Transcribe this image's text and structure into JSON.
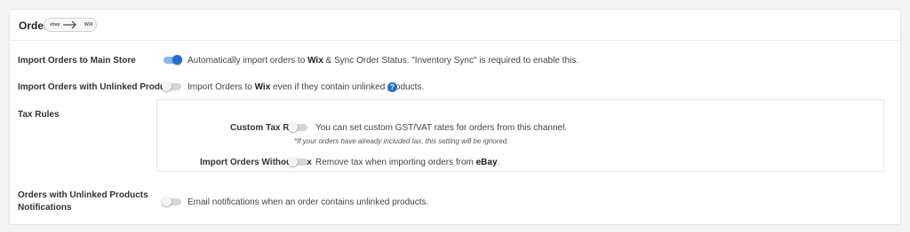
{
  "header": {
    "title": "Order",
    "flow_icon": "store-to-wix-flow-icon",
    "flow_left_logo": "ebay",
    "flow_right_logo": "wix"
  },
  "rows": {
    "import_main": {
      "label": "Import Orders to Main Store",
      "toggle_on": true,
      "desc_pre": "Automatically import orders to ",
      "desc_bold": "Wix",
      "desc_post": " & Sync Order Status. \"Inventory Sync\" is required to enable this."
    },
    "import_unlinked": {
      "label": "Import Orders with Unlinked Products",
      "toggle_on": false,
      "desc_pre": "Import Orders to ",
      "desc_bold": "Wix",
      "desc_post": " even if they contain unlinked products.",
      "help_icon": "question-circle-icon",
      "help_glyph": "?"
    },
    "tax_rules": {
      "label": "Tax Rules",
      "custom_tax": {
        "label": "Custom Tax Rate",
        "toggle_on": false,
        "desc": "You can set custom GST/VAT rates for orders from this channel.",
        "note": "*If your orders have already included tax, this setting will be ignored."
      },
      "without_tax": {
        "label": "Import Orders Without Tax",
        "toggle_on": false,
        "desc_pre": "Remove tax when importing orders from ",
        "desc_bold": "eBay",
        "desc_post": "."
      }
    },
    "notifications": {
      "label_line1": "Orders with Unlinked Products",
      "label_line2": "Notifications",
      "toggle_on": false,
      "desc": "Email notifications when an order contains unlinked products."
    }
  },
  "colors": {
    "accent": "#1f6fd1",
    "toggle_on_track": "#8fb4ea",
    "toggle_off_track": "#d6d6d6"
  }
}
